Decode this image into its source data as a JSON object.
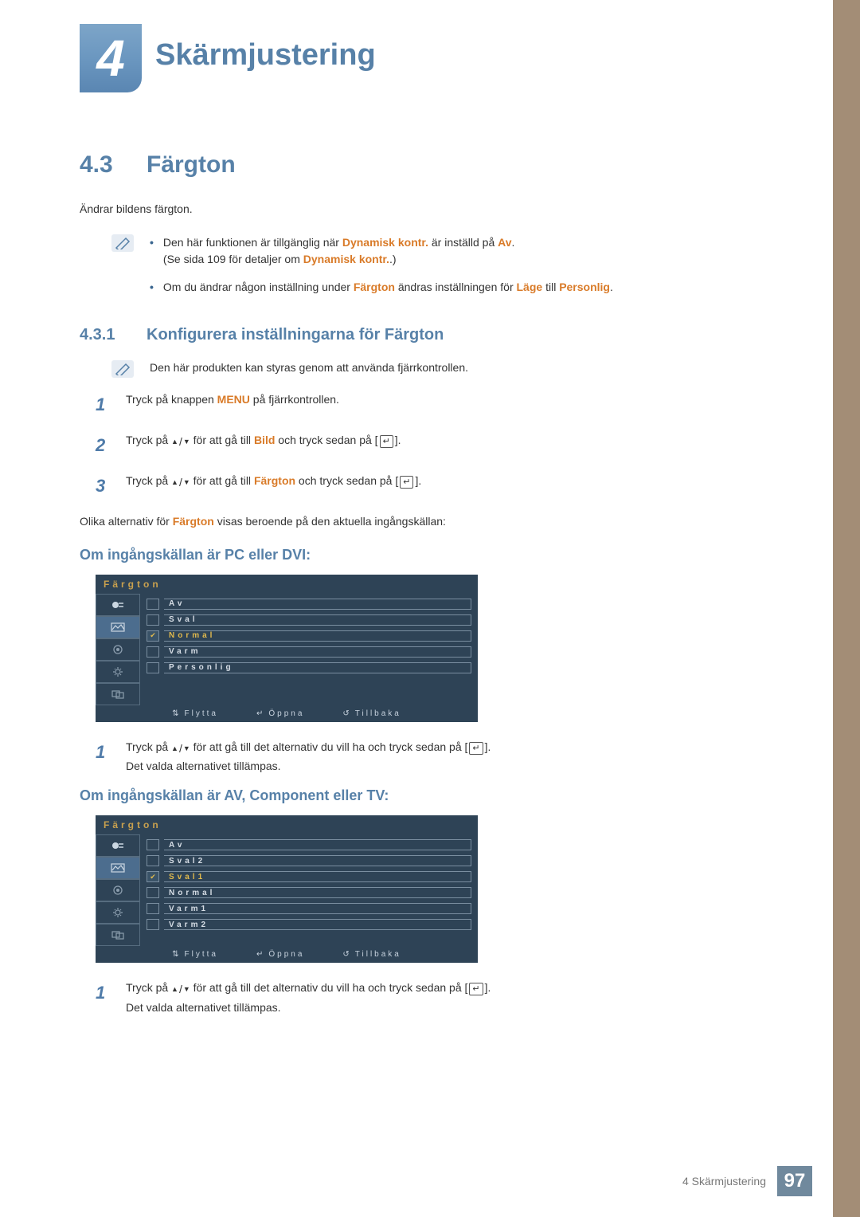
{
  "chapter": {
    "number": "4",
    "title": "Skärmjustering"
  },
  "section": {
    "number": "4.3",
    "title": "Färgton"
  },
  "intro": "Ändrar bildens färgton.",
  "notes": [
    "Den här funktionen är tillgänglig när Dynamisk kontr. är inställd på Av. (Se sida 109 för detaljer om Dynamisk kontr..)",
    "Om du ändrar någon inställning under Färgton ändras inställningen för Läge till Personlig."
  ],
  "note1_parts": {
    "pre": "Den här funktionen är tillgänglig när ",
    "kw1": "Dynamisk kontr.",
    "mid": " är inställd på ",
    "kw2": "Av",
    "post": ".",
    "line2_pre": "(Se sida 109 för detaljer om ",
    "line2_kw": "Dynamisk kontr.",
    "line2_post": ".)"
  },
  "note2_parts": {
    "pre": "Om du ändrar någon inställning under ",
    "kw1": "Färgton",
    "mid": " ändras inställningen för ",
    "kw2": "Läge",
    "mid2": " till ",
    "kw3": "Personlig",
    "post": "."
  },
  "subsection": {
    "number": "4.3.1",
    "title": "Konfigurera inställningarna för Färgton"
  },
  "subnote": "Den här produkten kan styras genom att använda fjärrkontrollen.",
  "steps": [
    {
      "n": "1",
      "pre": "Tryck på knappen ",
      "kw": "MENU",
      "post": " på fjärrkontrollen."
    },
    {
      "n": "2",
      "pre": "Tryck på ",
      "nav": true,
      "mid": " för att gå till ",
      "kw": "Bild",
      "post": " och tryck sedan på [",
      "icon": true,
      "end": "]."
    },
    {
      "n": "3",
      "pre": "Tryck på ",
      "nav": true,
      "mid": " för att gå till ",
      "kw": "Färgton",
      "post": " och tryck sedan på [",
      "icon": true,
      "end": "]."
    }
  ],
  "para1": {
    "pre": "Olika alternativ för ",
    "kw": "Färgton",
    "post": " visas beroende på den aktuella ingångskällan:"
  },
  "heading_pc": "Om ingångskällan är PC eller DVI:",
  "osd1": {
    "title": "Färgton",
    "items": [
      "Av",
      "Sval",
      "Normal",
      "Varm",
      "Personlig"
    ],
    "selected_index": 2,
    "foot": {
      "move": "Flytta",
      "open": "Öppna",
      "back": "Tillbaka"
    }
  },
  "step_after1": {
    "n": "1",
    "pre": "Tryck på ",
    "nav": true,
    "mid": " för att gå till det alternativ du vill ha och tryck sedan på [",
    "icon": true,
    "end": "].",
    "line2": "Det valda alternativet tillämpas."
  },
  "heading_av": "Om ingångskällan är AV, Component eller TV:",
  "osd2": {
    "title": "Färgton",
    "items": [
      "Av",
      "Sval2",
      "Sval1",
      "Normal",
      "Varm1",
      "Varm2"
    ],
    "selected_index": 2,
    "foot": {
      "move": "Flytta",
      "open": "Öppna",
      "back": "Tillbaka"
    }
  },
  "step_after2": {
    "n": "1",
    "pre": "Tryck på ",
    "nav": true,
    "mid": " för att gå till det alternativ du vill ha och tryck sedan på [",
    "icon": true,
    "end": "].",
    "line2": "Det valda alternativet tillämpas."
  },
  "footer": {
    "label": "4 Skärmjustering",
    "page": "97"
  }
}
